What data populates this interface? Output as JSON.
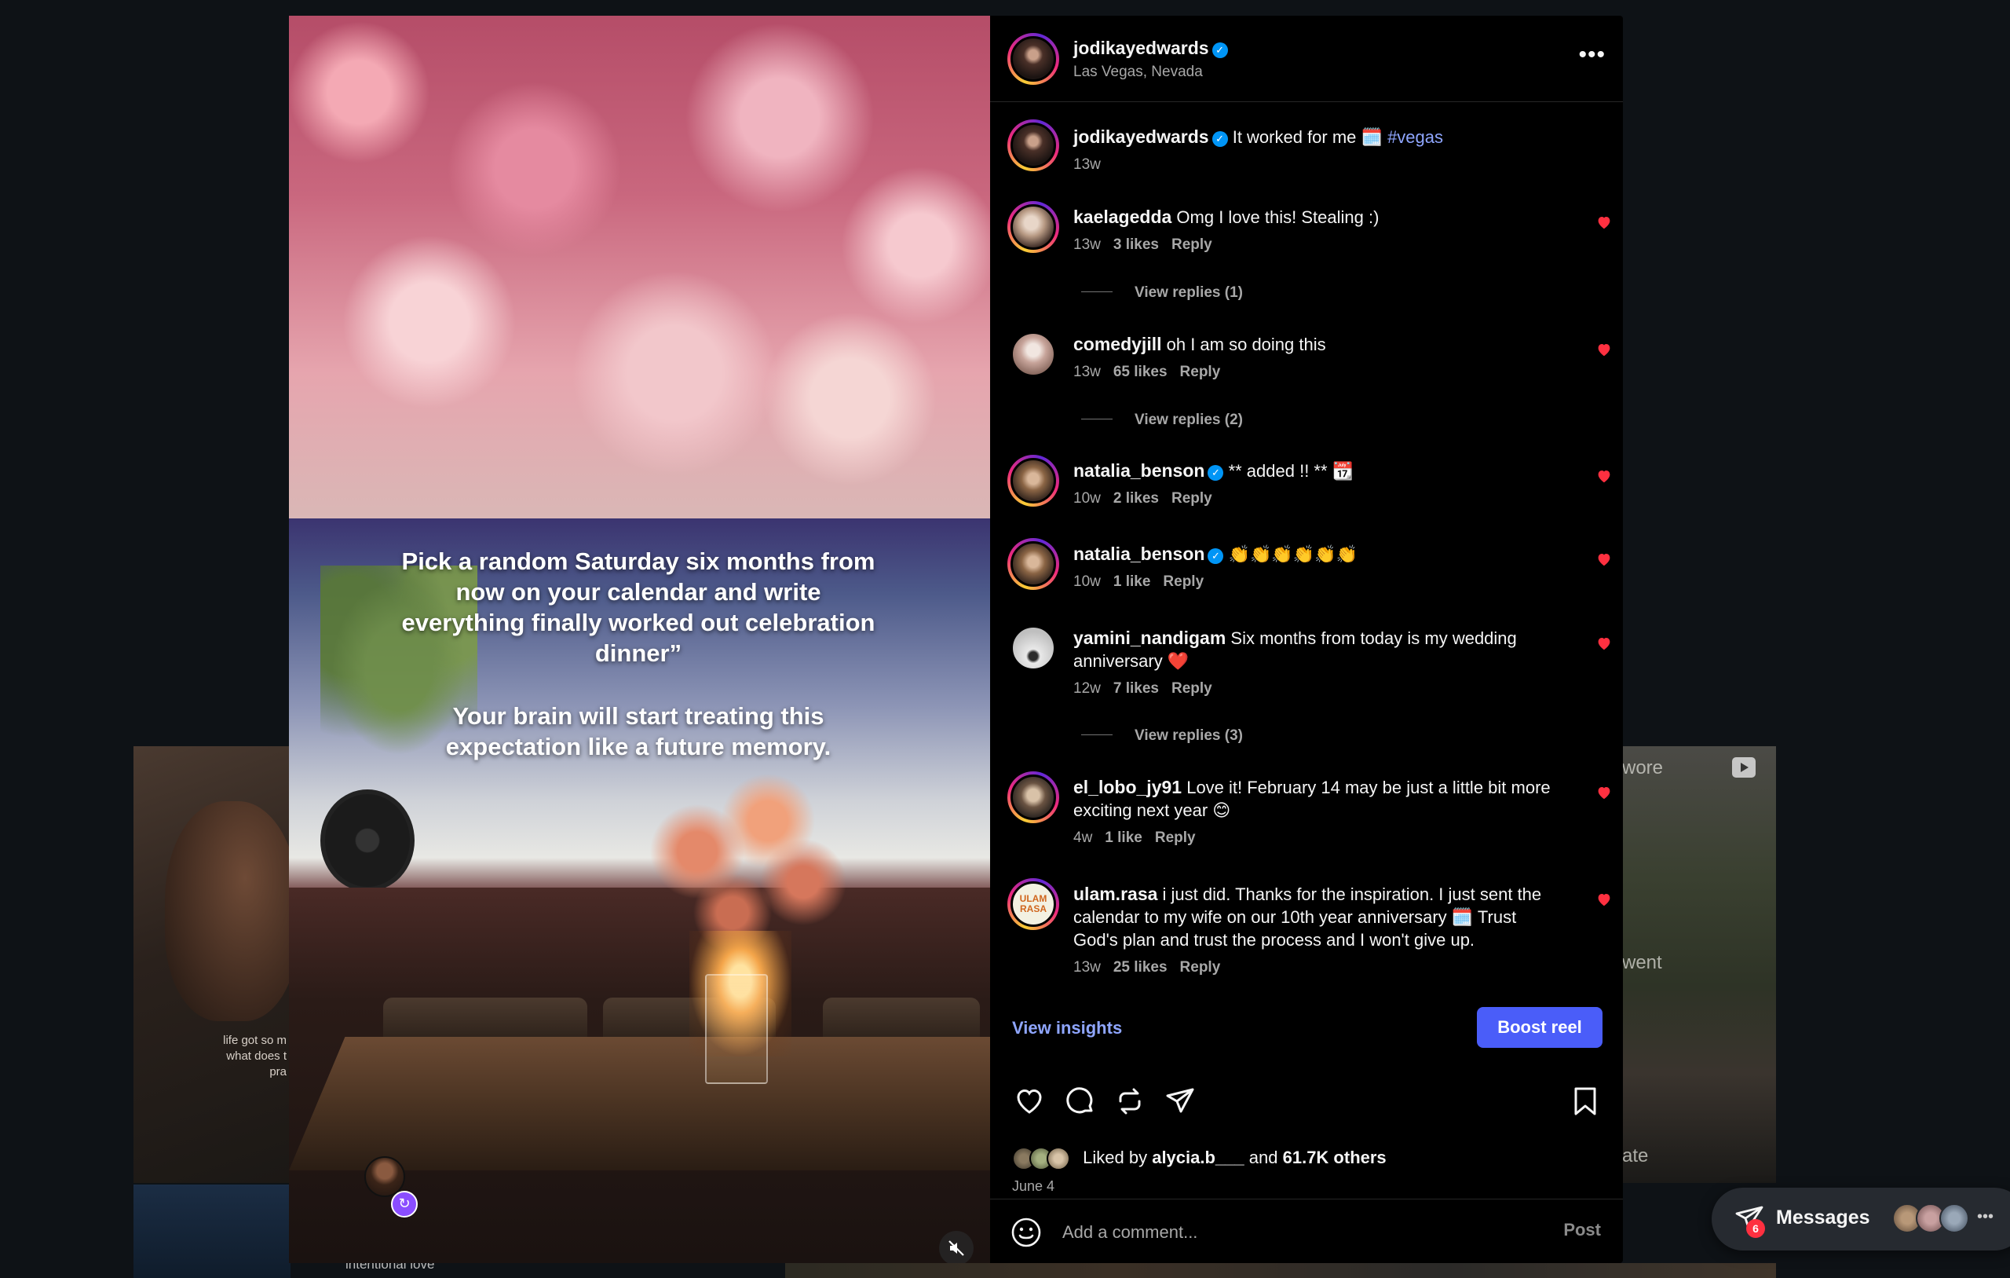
{
  "post": {
    "author": "jodikayedwards",
    "location": "Las Vegas, Nevada",
    "verified": true
  },
  "media": {
    "caption_line1": "Pick a random Saturday six months from now on your calendar and write everything finally worked out celebration dinner”",
    "caption_line2": "Your brain will start treating this expectation like a future memory."
  },
  "comments": [
    {
      "user": "jodikayedwards",
      "verified": true,
      "text": "It worked for me 🗓️",
      "hashtag": "#vegas",
      "time": "13w",
      "likes": "",
      "liked": false
    },
    {
      "user": "kaelagedda",
      "verified": false,
      "text": "Omg I love this! Stealing :)",
      "time": "13w",
      "likes": "3 likes",
      "reply": "Reply",
      "liked": true,
      "replies": "View replies (1)"
    },
    {
      "user": "comedyjill",
      "verified": false,
      "text": "oh I am so doing this",
      "time": "13w",
      "likes": "65 likes",
      "reply": "Reply",
      "liked": true,
      "replies": "View replies (2)"
    },
    {
      "user": "natalia_benson",
      "verified": true,
      "text": "** added !! ** 📆",
      "time": "10w",
      "likes": "2 likes",
      "reply": "Reply",
      "liked": true
    },
    {
      "user": "natalia_benson",
      "verified": true,
      "text": "👏👏👏👏👏👏",
      "time": "10w",
      "likes": "1 like",
      "reply": "Reply",
      "liked": true
    },
    {
      "user": "yamini_nandigam",
      "verified": false,
      "text": "Six months from today is my wedding anniversary ❤️",
      "time": "12w",
      "likes": "7 likes",
      "reply": "Reply",
      "liked": true,
      "replies": "View replies (3)"
    },
    {
      "user": "el_lobo_jy91",
      "verified": false,
      "text": "Love it! February 14 may be just a little bit more exciting next year 😊",
      "time": "4w",
      "likes": "1 like",
      "reply": "Reply",
      "liked": true
    },
    {
      "user": "ulam.rasa",
      "verified": false,
      "text": "i just did. Thanks for the inspiration. I just sent the calendar to my wife on our 10th year anniversary 🗓️ Trust God's plan and trust the process and I won't give up.",
      "time": "13w",
      "likes": "25 likes",
      "reply": "Reply",
      "liked": true,
      "avatar_text": "ULAM RASA"
    }
  ],
  "insights": {
    "view_label": "View insights",
    "boost_label": "Boost reel"
  },
  "engagement": {
    "liked_by_prefix": "Liked by",
    "liked_by_user": "alycia.b___",
    "and": "and",
    "others": "61.7K others",
    "date": "June 4"
  },
  "comment_box": {
    "placeholder": "Add a comment...",
    "post_label": "Post"
  },
  "messages": {
    "label": "Messages",
    "badge": "6"
  },
  "background": {
    "left_caption": "life got so m what does t pra",
    "left_strip": "intentional love",
    "right_word1": "wore",
    "right_word2": "went",
    "right_word3": "ate"
  },
  "colors": {
    "accent": "#4a5df9",
    "link": "#8fa6ff",
    "heart": "#ff3040",
    "verified": "#0095f6"
  }
}
